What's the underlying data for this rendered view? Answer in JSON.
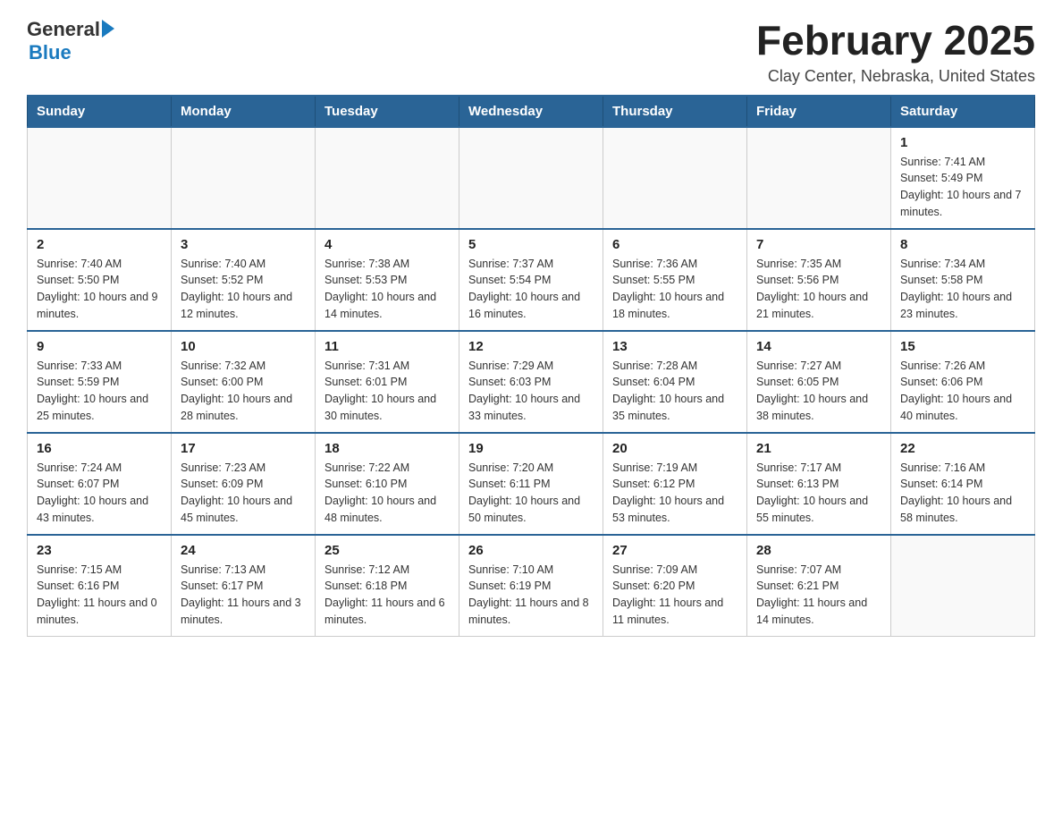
{
  "logo": {
    "general": "General",
    "blue": "Blue"
  },
  "title": "February 2025",
  "location": "Clay Center, Nebraska, United States",
  "days_of_week": [
    "Sunday",
    "Monday",
    "Tuesday",
    "Wednesday",
    "Thursday",
    "Friday",
    "Saturday"
  ],
  "weeks": [
    [
      {
        "day": "",
        "info": ""
      },
      {
        "day": "",
        "info": ""
      },
      {
        "day": "",
        "info": ""
      },
      {
        "day": "",
        "info": ""
      },
      {
        "day": "",
        "info": ""
      },
      {
        "day": "",
        "info": ""
      },
      {
        "day": "1",
        "info": "Sunrise: 7:41 AM\nSunset: 5:49 PM\nDaylight: 10 hours and 7 minutes."
      }
    ],
    [
      {
        "day": "2",
        "info": "Sunrise: 7:40 AM\nSunset: 5:50 PM\nDaylight: 10 hours and 9 minutes."
      },
      {
        "day": "3",
        "info": "Sunrise: 7:40 AM\nSunset: 5:52 PM\nDaylight: 10 hours and 12 minutes."
      },
      {
        "day": "4",
        "info": "Sunrise: 7:38 AM\nSunset: 5:53 PM\nDaylight: 10 hours and 14 minutes."
      },
      {
        "day": "5",
        "info": "Sunrise: 7:37 AM\nSunset: 5:54 PM\nDaylight: 10 hours and 16 minutes."
      },
      {
        "day": "6",
        "info": "Sunrise: 7:36 AM\nSunset: 5:55 PM\nDaylight: 10 hours and 18 minutes."
      },
      {
        "day": "7",
        "info": "Sunrise: 7:35 AM\nSunset: 5:56 PM\nDaylight: 10 hours and 21 minutes."
      },
      {
        "day": "8",
        "info": "Sunrise: 7:34 AM\nSunset: 5:58 PM\nDaylight: 10 hours and 23 minutes."
      }
    ],
    [
      {
        "day": "9",
        "info": "Sunrise: 7:33 AM\nSunset: 5:59 PM\nDaylight: 10 hours and 25 minutes."
      },
      {
        "day": "10",
        "info": "Sunrise: 7:32 AM\nSunset: 6:00 PM\nDaylight: 10 hours and 28 minutes."
      },
      {
        "day": "11",
        "info": "Sunrise: 7:31 AM\nSunset: 6:01 PM\nDaylight: 10 hours and 30 minutes."
      },
      {
        "day": "12",
        "info": "Sunrise: 7:29 AM\nSunset: 6:03 PM\nDaylight: 10 hours and 33 minutes."
      },
      {
        "day": "13",
        "info": "Sunrise: 7:28 AM\nSunset: 6:04 PM\nDaylight: 10 hours and 35 minutes."
      },
      {
        "day": "14",
        "info": "Sunrise: 7:27 AM\nSunset: 6:05 PM\nDaylight: 10 hours and 38 minutes."
      },
      {
        "day": "15",
        "info": "Sunrise: 7:26 AM\nSunset: 6:06 PM\nDaylight: 10 hours and 40 minutes."
      }
    ],
    [
      {
        "day": "16",
        "info": "Sunrise: 7:24 AM\nSunset: 6:07 PM\nDaylight: 10 hours and 43 minutes."
      },
      {
        "day": "17",
        "info": "Sunrise: 7:23 AM\nSunset: 6:09 PM\nDaylight: 10 hours and 45 minutes."
      },
      {
        "day": "18",
        "info": "Sunrise: 7:22 AM\nSunset: 6:10 PM\nDaylight: 10 hours and 48 minutes."
      },
      {
        "day": "19",
        "info": "Sunrise: 7:20 AM\nSunset: 6:11 PM\nDaylight: 10 hours and 50 minutes."
      },
      {
        "day": "20",
        "info": "Sunrise: 7:19 AM\nSunset: 6:12 PM\nDaylight: 10 hours and 53 minutes."
      },
      {
        "day": "21",
        "info": "Sunrise: 7:17 AM\nSunset: 6:13 PM\nDaylight: 10 hours and 55 minutes."
      },
      {
        "day": "22",
        "info": "Sunrise: 7:16 AM\nSunset: 6:14 PM\nDaylight: 10 hours and 58 minutes."
      }
    ],
    [
      {
        "day": "23",
        "info": "Sunrise: 7:15 AM\nSunset: 6:16 PM\nDaylight: 11 hours and 0 minutes."
      },
      {
        "day": "24",
        "info": "Sunrise: 7:13 AM\nSunset: 6:17 PM\nDaylight: 11 hours and 3 minutes."
      },
      {
        "day": "25",
        "info": "Sunrise: 7:12 AM\nSunset: 6:18 PM\nDaylight: 11 hours and 6 minutes."
      },
      {
        "day": "26",
        "info": "Sunrise: 7:10 AM\nSunset: 6:19 PM\nDaylight: 11 hours and 8 minutes."
      },
      {
        "day": "27",
        "info": "Sunrise: 7:09 AM\nSunset: 6:20 PM\nDaylight: 11 hours and 11 minutes."
      },
      {
        "day": "28",
        "info": "Sunrise: 7:07 AM\nSunset: 6:21 PM\nDaylight: 11 hours and 14 minutes."
      },
      {
        "day": "",
        "info": ""
      }
    ]
  ]
}
